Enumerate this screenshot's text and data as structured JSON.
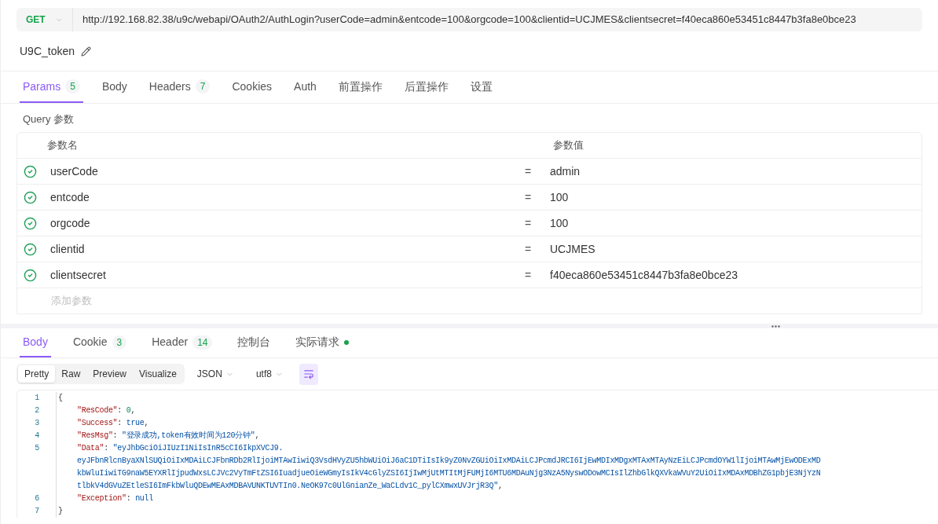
{
  "request": {
    "method": "GET",
    "url": "http://192.168.82.38/u9c/webapi/OAuth2/AuthLogin?userCode=admin&entcode=100&orgcode=100&clientid=UCJMES&clientsecret=f40eca860e53451c8447b3fa8e0bce23",
    "name": "U9C_token"
  },
  "request_tabs": [
    {
      "label": "Params",
      "count": "5",
      "selected": true
    },
    {
      "label": "Body",
      "selected": false
    },
    {
      "label": "Headers",
      "count": "7",
      "selected": false
    },
    {
      "label": "Cookies",
      "selected": false
    },
    {
      "label": "Auth",
      "selected": false
    },
    {
      "label": "前置操作",
      "selected": false
    },
    {
      "label": "后置操作",
      "selected": false
    },
    {
      "label": "设置",
      "selected": false
    }
  ],
  "query": {
    "title": "Query 参数",
    "columns": [
      "参数名",
      "参数值"
    ],
    "rows": [
      {
        "checked": true,
        "key": "userCode",
        "sign": "=",
        "value": "admin"
      },
      {
        "checked": true,
        "key": "entcode",
        "sign": "=",
        "value": "100"
      },
      {
        "checked": true,
        "key": "orgcode",
        "sign": "=",
        "value": "100"
      },
      {
        "checked": true,
        "key": "clientid",
        "sign": "=",
        "value": "UCJMES"
      },
      {
        "checked": true,
        "key": "clientsecret",
        "sign": "=",
        "value": "f40eca860e53451c8447b3fa8e0bce23"
      }
    ],
    "placeholder": "添加参数"
  },
  "response_tabs": [
    {
      "label": "Body",
      "selected": true
    },
    {
      "label": "Cookie",
      "count": "3",
      "selected": false
    },
    {
      "label": "Header",
      "count": "14",
      "selected": false
    },
    {
      "label": "控制台",
      "selected": false
    },
    {
      "label": "实际请求",
      "dot": true,
      "selected": false
    }
  ],
  "view_modes": [
    {
      "label": "Pretty",
      "selected": true
    },
    {
      "label": "Raw",
      "selected": false
    },
    {
      "label": "Preview",
      "selected": false
    },
    {
      "label": "Visualize",
      "selected": false
    }
  ],
  "format": "JSON",
  "encoding": "utf8",
  "wrap_on": true,
  "code": [
    {
      "number": "1",
      "lines": [
        [
          {
            "kind": "punct",
            "text": "{"
          }
        ]
      ]
    },
    {
      "number": "2",
      "lines": [
        [
          {
            "kind": "key",
            "text": "\"ResCode\""
          },
          {
            "kind": "punct",
            "text": ": "
          },
          {
            "kind": "number",
            "text": "0"
          },
          {
            "kind": "punct",
            "text": ","
          }
        ]
      ]
    },
    {
      "number": "3",
      "lines": [
        [
          {
            "kind": "key",
            "text": "\"Success\""
          },
          {
            "kind": "punct",
            "text": ": "
          },
          {
            "kind": "literal",
            "text": "true"
          },
          {
            "kind": "punct",
            "text": ","
          }
        ]
      ]
    },
    {
      "number": "4",
      "lines": [
        [
          {
            "kind": "key",
            "text": "\"ResMsg\""
          },
          {
            "kind": "punct",
            "text": ": "
          },
          {
            "kind": "string",
            "text": "\"登录成功,token有效时间为120分钟\""
          },
          {
            "kind": "punct",
            "text": ","
          }
        ]
      ]
    },
    {
      "number": "5",
      "lines": [
        [
          {
            "kind": "key",
            "text": "\"Data\""
          },
          {
            "kind": "punct",
            "text": ": "
          },
          {
            "kind": "string",
            "text": "\"eyJhbGciOiJIUzI1NiIsInR5cCI6IkpXVCJ9."
          }
        ],
        [
          {
            "kind": "string",
            "text": "eyJFbnRlcnByaXNlSUQiOiIxMDAiLCJFbnRDb2RlIjoiMTAwIiwiQ3VsdHVyZU5hbWUiOiJ6aC1DTiIsIk9yZ0NvZGUiOiIxMDAiLCJPcmdJRCI6IjEwMDIxMDgxMTAxMTAyNzEiLCJPcmdOYW1lIjoiMTAwMjEwODExMD"
          }
        ],
        [
          {
            "kind": "string",
            "text": "kbWluIiwiTG9naW5EYXRlIjpudWxsLCJVc2VyTmFtZSI6IuadjueOieWGmyIsIkV4cGlyZSI6IjIwMjUtMTItMjFUMjI6MTU6MDAuNjg3NzA5NyswODowMCIsIlZhbGlkQXVkaWVuY2UiOiIxMDAxMDBhZG1pbjE3NjYzN"
          }
        ],
        [
          {
            "kind": "string",
            "text": "tlbkV4dGVuZEtleSI6ImFkbWluQDEwMEAxMDBAVUNKTUVTIn0.NeOK97c0UlGnianZe_WaCLdv1C_pylCXmwxUVJrjR3Q\""
          },
          {
            "kind": "punct",
            "text": ","
          }
        ]
      ]
    },
    {
      "number": "6",
      "lines": [
        [
          {
            "kind": "key",
            "text": "\"Exception\""
          },
          {
            "kind": "punct",
            "text": ": "
          },
          {
            "kind": "literal",
            "text": "null"
          }
        ]
      ]
    },
    {
      "number": "7",
      "lines": [
        [
          {
            "kind": "punct",
            "text": "}"
          }
        ]
      ]
    }
  ]
}
